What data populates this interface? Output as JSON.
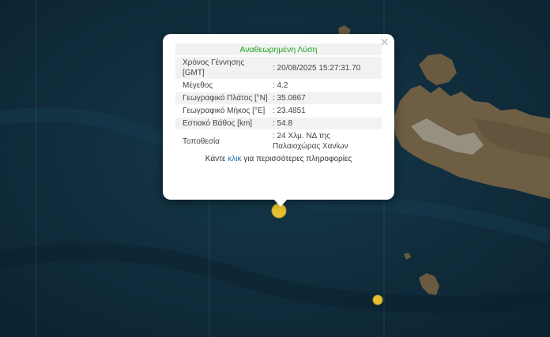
{
  "popup": {
    "title": "Αναθεωρημένη Λύση",
    "close_symbol": "×",
    "rows": [
      {
        "label": "Χρόνος Γέννησης [GMT]",
        "value": ": 20/08/2025 15:27:31.70"
      },
      {
        "label": "Μέγεθος",
        "value": ": 4.2"
      },
      {
        "label": "Γεωγραφικό Πλάτος [°N]",
        "value": ": 35.0867"
      },
      {
        "label": "Γεωγραφικό Μήκος [°E]",
        "value": ": 23.4851"
      },
      {
        "label": "Εστιακό Βάθος [km]",
        "value": ": 54.8"
      },
      {
        "label": "Τοποθεσία",
        "value": ": 24 Χλμ. ΝΔ της Παλαιοχώρας Χανίων"
      }
    ],
    "more_prefix": "Κάντε ",
    "more_link": "κλικ",
    "more_suffix": " για περισσότερες πληροφορίες"
  },
  "colors": {
    "sea": "#102c3c",
    "land": "#6e5e44",
    "marker": "#e6c030",
    "title": "#24a023",
    "link": "#1b6fb8"
  },
  "icons": {
    "close": "close-icon",
    "marker": "earthquake-marker"
  }
}
